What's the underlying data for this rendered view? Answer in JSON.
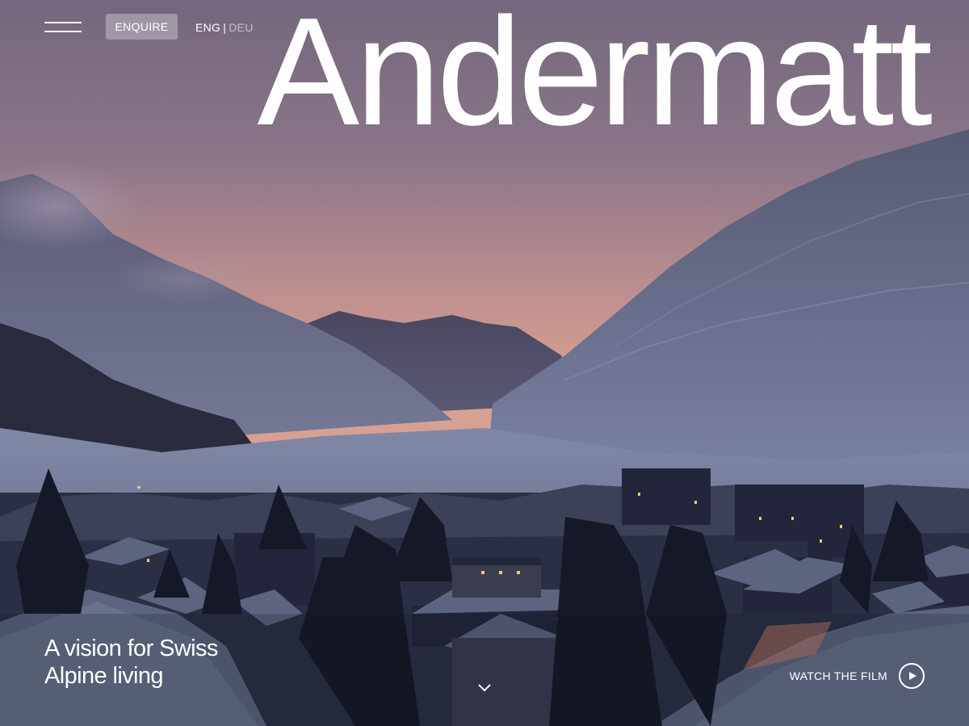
{
  "hero": {
    "title": "Andermatt",
    "tagline_line1": "A vision for Swiss",
    "tagline_line2": "Alpine living"
  },
  "header": {
    "enquire_label": "ENQUIRE",
    "lang_active": "ENG",
    "lang_separator": "|",
    "lang_inactive": "DEU",
    "menu_icon": "hamburger-menu-icon"
  },
  "footer": {
    "watch_film_label": "WATCH THE FILM",
    "play_icon": "play-icon",
    "scroll_icon": "chevron-down-icon"
  },
  "colors": {
    "sky_top": "#74687e",
    "sky_horizon": "#cf9b94",
    "text": "#ffffff",
    "button_bg": "rgba(255,255,255,0.30)"
  }
}
